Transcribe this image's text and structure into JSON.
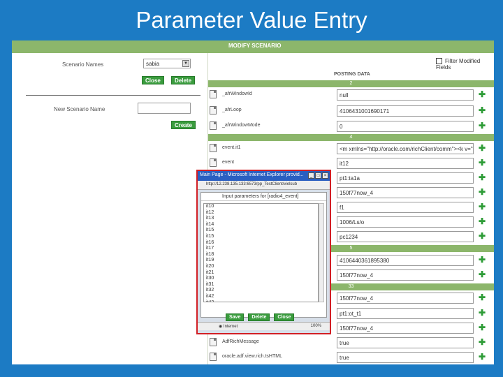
{
  "slide": {
    "title": "Parameter Value Entry"
  },
  "header": {
    "title": "MODIFY SCENARIO"
  },
  "left": {
    "scenario_label": "Scenario Names",
    "scenario_value": "sabia",
    "close_label": "Close",
    "delete_label": "Delete",
    "new_label": "New Scenario Name",
    "create_label": "Create"
  },
  "right": {
    "filter_label": "Filter Modified Fields",
    "posting_label": "POSTING DATA",
    "bands": [
      "2",
      "4",
      "5",
      "33"
    ],
    "rows": [
      {
        "name": "_afrWindowId",
        "value": "null"
      },
      {
        "name": "_afrLoop",
        "value": "4106431001690171"
      },
      {
        "name": "_afrWindowMode",
        "value": "0"
      },
      {
        "name": "event.it1",
        "value": "<m xmlns=\"http://oracle.com/richClient/comm\"><k v=\"ty"
      },
      {
        "name": "event",
        "value": "it12"
      },
      {
        "name": "",
        "value": "pt1:ta1a"
      },
      {
        "name": "",
        "value": "150f77now_4"
      },
      {
        "name": "",
        "value": "f1"
      },
      {
        "name": "",
        "value": "1006/Ls/o"
      },
      {
        "name": "",
        "value": "pc1234"
      },
      {
        "name": "",
        "value": "4106440361895380"
      },
      {
        "name": "",
        "value": "150f77now_4"
      },
      {
        "name": "",
        "value": "150f77now_4"
      },
      {
        "name": "",
        "value": "pt1:ot_t1"
      },
      {
        "name": "",
        "value": "150f77now_4"
      },
      {
        "name": "AdfRichMessage",
        "value": "true"
      },
      {
        "name": "oracle.adf.view.rich.tsHTML",
        "value": "true"
      }
    ]
  },
  "popup": {
    "title": "Main Page - Microsoft Internet Explorer provid...",
    "address": "http://12.238.135.133:6573/pp_TestClient/vielsub",
    "heading": "Input parameters for [radio4_event]",
    "items": [
      "it10",
      "it12",
      "it13",
      "it14",
      "it15",
      "it15",
      "it16",
      "it17",
      "it18",
      "it19",
      "it20",
      "it21",
      "it30",
      "it31",
      "it32",
      "it42",
      "it43"
    ],
    "save_label": "Save",
    "delete_label": "Delete",
    "close_label": "Close",
    "status_text": "Internet",
    "zoom": "100%"
  }
}
